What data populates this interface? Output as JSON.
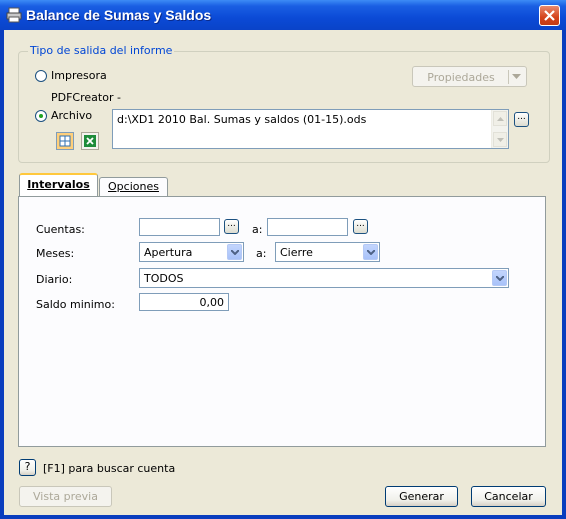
{
  "window": {
    "title": "Balance de Sumas y Saldos"
  },
  "output_group": {
    "legend": "Tipo de salida del informe",
    "printer_option": {
      "label": "Impresora",
      "selected": false
    },
    "printer_name": "PDFCreator -",
    "properties_button": "Propiedades",
    "file_option": {
      "label": "Archivo",
      "selected": true
    },
    "file_path": "d:\\XD1 2010 Bal. Sumas y saldos (01-15).ods",
    "browse_button": "..."
  },
  "tabs": [
    {
      "label": "Intervalos",
      "active": true
    },
    {
      "label": "Opciones",
      "active": false
    }
  ],
  "intervals": {
    "cuentas_label": "Cuentas:",
    "cuentas_from": "",
    "cuentas_to": "",
    "range_sep": "a:",
    "lookup_button": "...",
    "meses_label": "Meses:",
    "meses_from": "Apertura",
    "meses_to": "Cierre",
    "diario_label": "Diario:",
    "diario_value": "TODOS",
    "saldo_label": "Saldo minimo:",
    "saldo_value": "0,00"
  },
  "footer": {
    "help_key": "?",
    "help_text": "[F1] para buscar cuenta",
    "preview_button": "Vista previa",
    "generate_button": "Generar",
    "cancel_button": "Cancelar"
  },
  "colors": {
    "title_bar": "#0b4ad6",
    "dialog_bg": "#ece9d8",
    "group_legend": "#0046d5",
    "tab_highlight": "#ffc83c",
    "radio_dot": "#21a121"
  }
}
